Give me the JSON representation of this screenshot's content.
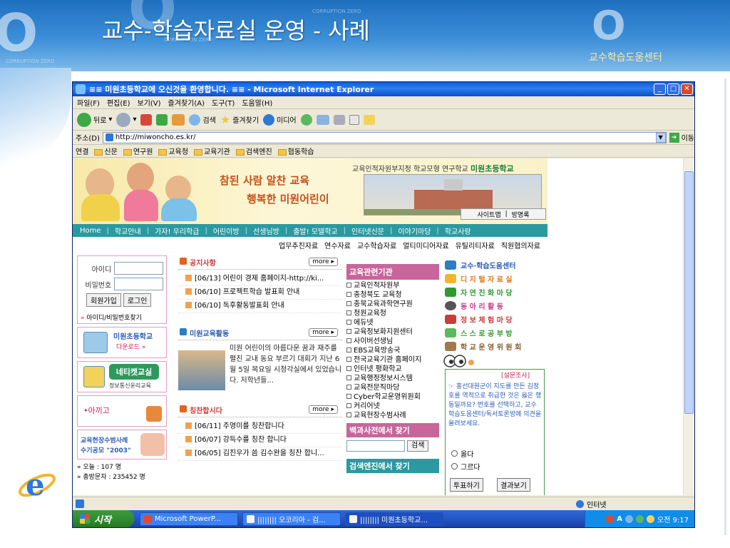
{
  "slide": {
    "title": "교수-학습자료실 운영 - 사례",
    "subtitle": "교수학습도움센터",
    "watermark": "CORRUPTION ZERO"
  },
  "browser": {
    "window_title": "≡≡ 미원초등학교에 오신것을 환영합니다. ≡≡ - Microsoft Internet Explorer",
    "menu": [
      "파일(F)",
      "편집(E)",
      "보기(V)",
      "즐겨찾기(A)",
      "도구(T)",
      "도움말(H)"
    ],
    "toolbar": {
      "back": "뒤로",
      "search": "검색",
      "favorites": "즐겨찾기",
      "media": "미디어"
    },
    "address": {
      "label": "주소(D)",
      "url": "http://miwoncho.es.kr/",
      "go": "이동"
    },
    "links": {
      "label": "연결",
      "items": [
        "신문",
        "연구원",
        "교육청",
        "교육기관",
        "검색엔진",
        "협동학습"
      ]
    },
    "status": {
      "zone": "인터넷"
    }
  },
  "site": {
    "slogan_line1": "참된 사람 알찬 교육",
    "slogan_line2": "행복한 미원어린이",
    "school_tag": "교육인적자원부지정 학교모형 연구학교",
    "school_name": "미원초등학교",
    "util_links": [
      "사이트맵",
      "방명록"
    ],
    "nav": [
      "Home",
      "학교안내",
      "가자! 우리학급",
      "어린이방",
      "선생님방",
      "출발! 모델학교",
      "인터넷신문",
      "이야기마당",
      "학교사랑"
    ],
    "subnav": [
      "업무추진자료",
      "연수자료",
      "교수학습자료",
      "멀티미디어자료",
      "유틸리티자료",
      "직원협의자료"
    ],
    "login": {
      "id_label": "아이디",
      "pw_label": "비밀번호",
      "join": "회원가입",
      "login": "로그인",
      "find": "아이디/비밀번호찾기"
    },
    "left_boxes": {
      "download_title": "미원초등학교",
      "download_sub": "다운로드 »",
      "netiquette": "네티켓교실",
      "netiquette_sub": "정보통신윤리교육",
      "achigo": "•아끼고",
      "essay_line1": "교육현장수범사례",
      "essay_line2": "수기공모 \"2003\"",
      "today": "» 오늘 : 107 명",
      "total": "» 총방문자 : 235452 명"
    },
    "notice": {
      "title": "공지사항",
      "more": "more",
      "items": [
        "[06/13] 어린이 경제 홈페이지-http://ki...",
        "[06/10] 프로젝트학습 발표회 안내",
        "[06/10] 독후활동발표회 안내"
      ]
    },
    "activity": {
      "title": "미원교육활동",
      "more": "more",
      "text": "미원 어린이의 아름다운 꿈과 재주를 펼친 교내 동요 부르기 대회가 지난 6월 5일 목요일 시청각실에서 있었습니다. 저학년들..."
    },
    "praise": {
      "title": "칭찬합시다",
      "more": "more",
      "items": [
        "[06/11] 주영미를 칭찬합니다",
        "[06/07] 강득수를 칭찬 합니다",
        "[06/05] 김진우가 씀 김수완을 칭찬 합니..."
      ]
    },
    "organizations": {
      "title": "교육관련기관",
      "items": [
        "교육인적자원부",
        "충청북도 교육청",
        "충북교육과학연구원",
        "청원교육청",
        "에듀넷",
        "교육정보화지원센터",
        "사이버선생님",
        "EBS교육방송국",
        "전국교육기관 홈페이지",
        "인터넷 평화학교",
        "교육행정정보시스템",
        "교육전문직마당",
        "Cyber학교운영위원회",
        "커리어넷",
        "교육현장수범사례"
      ]
    },
    "encyclopedia": {
      "title": "백과사전에서 찾기",
      "button": "검색"
    },
    "search_engine": {
      "title": "검색엔진에서 찾기"
    },
    "right_links": [
      {
        "label": "교수·학습도움센터",
        "color": "#2b5bb8"
      },
      {
        "label": "디 지 털  자 료 실",
        "color": "#e0781a"
      },
      {
        "label": "자 연 친 화 마 당",
        "color": "#2f9a2f"
      },
      {
        "label": "동  아  리  활  동",
        "color": "#c83c8c"
      },
      {
        "label": "정 보 체 험 마 당",
        "color": "#c83c3c"
      },
      {
        "label": "스 스 로 공 부 방",
        "color": "#2f9a2f"
      },
      {
        "label": "학 교 운 영 위 원 회",
        "color": "#8a5a2a"
      }
    ],
    "survey": {
      "tag": "[설문조사]",
      "question": "☞ 홍선대원군이 지도를 만든 김정호를 역적으로 취급한 것은 옳은 행동일까요? 번호를 선택하고, 교수학습도움센터/독서토론방에 의견을 올려보세요.",
      "options": [
        "옳다",
        "그르다"
      ],
      "vote": "투표하기",
      "result": "결과보기"
    }
  },
  "taskbar": {
    "start": "시작",
    "tasks": [
      "Microsoft PowerP...",
      "|||||||| 오코리아 - 검...",
      "|||||||| 미원초등학교..."
    ],
    "clock": "오전 9:17"
  },
  "colors": {
    "accent": "#2b9aa0",
    "pink": "#c8659b",
    "xp_blue": "#2457c2"
  }
}
